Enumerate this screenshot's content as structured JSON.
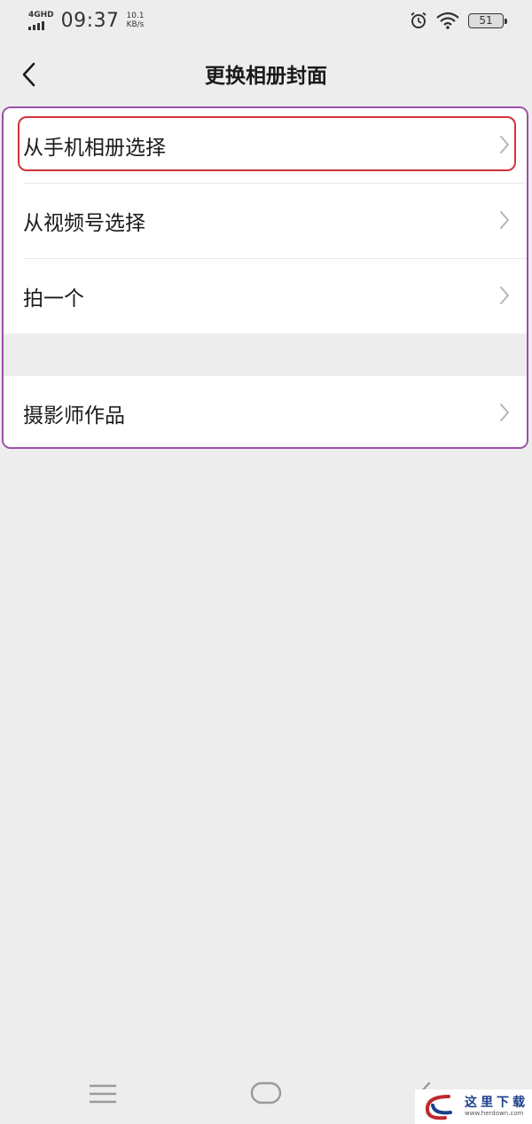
{
  "status_bar": {
    "network": "4GHD",
    "time": "09:37",
    "speed_value": "10.1",
    "speed_unit": "KB/s",
    "battery": "51"
  },
  "nav": {
    "title": "更换相册封面"
  },
  "menu": {
    "items": [
      {
        "label": "从手机相册选择"
      },
      {
        "label": "从视频号选择"
      },
      {
        "label": "拍一个"
      },
      {
        "label": "摄影师作品"
      }
    ]
  },
  "watermark": {
    "title": "这里下载",
    "url": "www.herdown.com"
  },
  "colors": {
    "background": "#ededed",
    "item_background": "#ffffff",
    "highlight_red": "#d2333b",
    "panel_purple": "#9b4fa8"
  }
}
